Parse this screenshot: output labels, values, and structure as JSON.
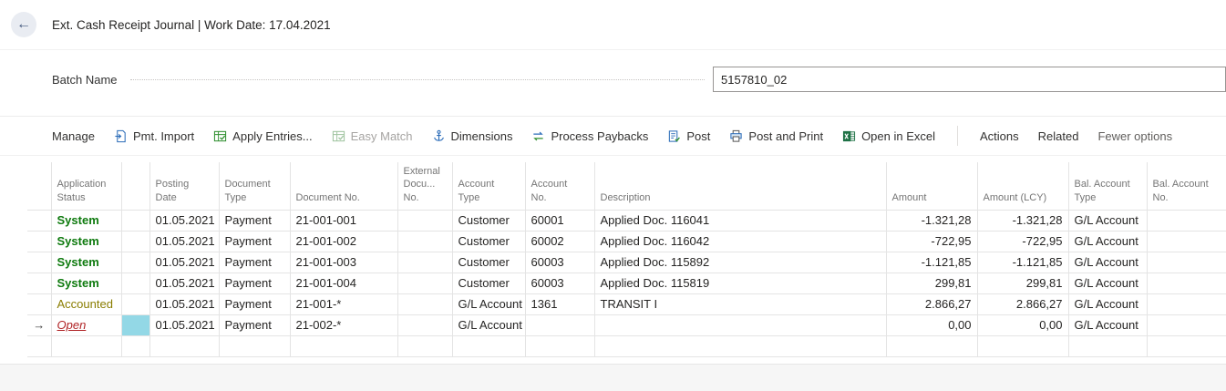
{
  "app": {
    "title": "Ext. Cash Receipt Journal | Work Date: 17.04.2021"
  },
  "icons": {
    "back": "←",
    "selected_marker": "→"
  },
  "batch": {
    "label": "Batch Name",
    "value": "5157810_02"
  },
  "toolbar": {
    "manage": "Manage",
    "pmt_import": "Pmt. Import",
    "apply_entries": "Apply Entries...",
    "easy_match": "Easy Match",
    "dimensions": "Dimensions",
    "process_paybacks": "Process Paybacks",
    "post": "Post",
    "post_and_print": "Post and Print",
    "open_in_excel": "Open in Excel",
    "actions": "Actions",
    "related": "Related",
    "fewer_options": "Fewer options"
  },
  "table": {
    "columns": {
      "application_status": "Application\nStatus",
      "posting_date": "Posting\nDate",
      "document_type": "Document\nType",
      "document_no": "Document No.",
      "external_doc_no": "External\nDocu...\nNo.",
      "account_type": "Account\nType",
      "account_no": "Account\nNo.",
      "description": "Description",
      "amount": "Amount",
      "amount_lcy": "Amount (LCY)",
      "bal_account_type": "Bal. Account\nType",
      "bal_account_no": "Bal. Account\nNo."
    },
    "rows": [
      {
        "status": "System",
        "posting_date": "01.05.2021",
        "doc_type": "Payment",
        "doc_no": "21-001-001",
        "ext_doc_no": "",
        "account_type": "Customer",
        "account_no": "60001",
        "description": "Applied Doc. 116041",
        "amount": "-1.321,28",
        "amount_lcy": "-1.321,28",
        "bal_account_type": "G/L Account",
        "bal_account_no": ""
      },
      {
        "status": "System",
        "posting_date": "01.05.2021",
        "doc_type": "Payment",
        "doc_no": "21-001-002",
        "ext_doc_no": "",
        "account_type": "Customer",
        "account_no": "60002",
        "description": "Applied Doc. 116042",
        "amount": "-722,95",
        "amount_lcy": "-722,95",
        "bal_account_type": "G/L Account",
        "bal_account_no": ""
      },
      {
        "status": "System",
        "posting_date": "01.05.2021",
        "doc_type": "Payment",
        "doc_no": "21-001-003",
        "ext_doc_no": "",
        "account_type": "Customer",
        "account_no": "60003",
        "description": "Applied Doc. 115892",
        "amount": "-1.121,85",
        "amount_lcy": "-1.121,85",
        "bal_account_type": "G/L Account",
        "bal_account_no": ""
      },
      {
        "status": "System",
        "posting_date": "01.05.2021",
        "doc_type": "Payment",
        "doc_no": "21-001-004",
        "ext_doc_no": "",
        "account_type": "Customer",
        "account_no": "60003",
        "description": "Applied Doc. 115819",
        "amount": "299,81",
        "amount_lcy": "299,81",
        "bal_account_type": "G/L Account",
        "bal_account_no": ""
      },
      {
        "status": "Accounted",
        "posting_date": "01.05.2021",
        "doc_type": "Payment",
        "doc_no": "21-001-*",
        "ext_doc_no": "",
        "account_type": "G/L Account",
        "account_no": "1361",
        "description": "TRANSIT I",
        "amount": "2.866,27",
        "amount_lcy": "2.866,27",
        "bal_account_type": "G/L Account",
        "bal_account_no": ""
      },
      {
        "status": "Open",
        "posting_date": "01.05.2021",
        "doc_type": "Payment",
        "doc_no": "21-002-*",
        "ext_doc_no": "",
        "account_type": "G/L Account",
        "account_no": "",
        "description": "",
        "amount": "0,00",
        "amount_lcy": "0,00",
        "bal_account_type": "G/L Account",
        "bal_account_no": ""
      }
    ]
  },
  "colors": {
    "status_system": "#0e7a0e",
    "status_accounted": "#8a7d00",
    "status_open": "#b02325",
    "selected_cell": "#93d8e6",
    "accent_blue": "#2b6cb8",
    "accent_green": "#2f8f2f",
    "excel_green": "#1e7145"
  }
}
